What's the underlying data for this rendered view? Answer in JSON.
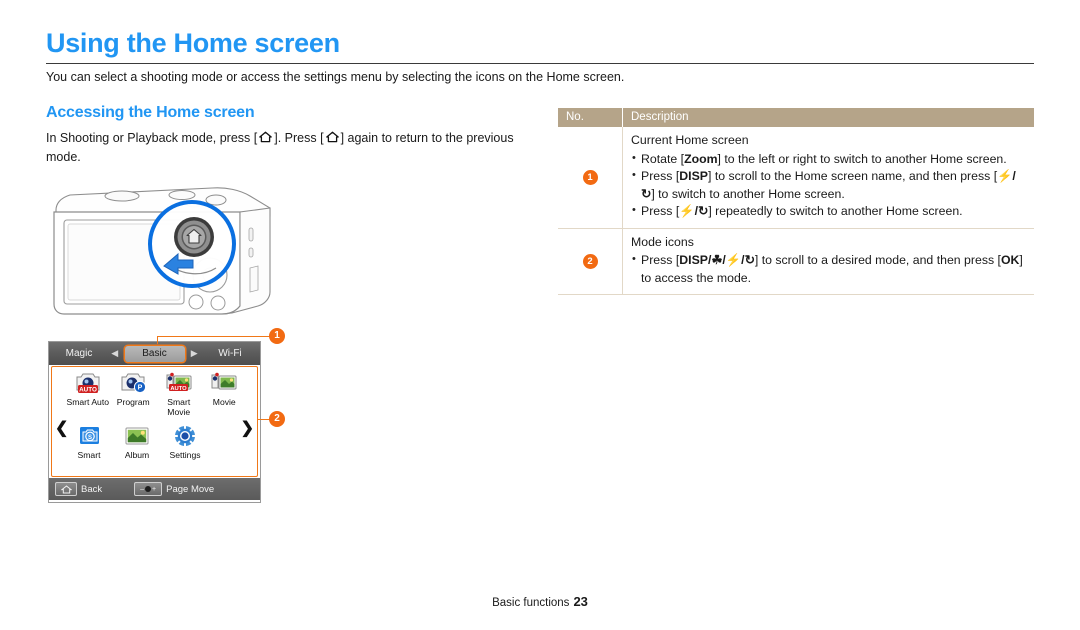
{
  "page": {
    "title": "Using the Home screen",
    "intro": "You can select a shooting mode or access the settings menu by selecting the icons on the Home screen.",
    "footer_label": "Basic functions",
    "footer_page": "23",
    "accent_blue": "#2196f3",
    "accent_orange": "#f26a12",
    "table_header_bg": "#b5a489"
  },
  "section": {
    "heading": "Accessing the Home screen",
    "body_part1": "In Shooting or Playback mode, press [",
    "body_part2": "]. Press [",
    "body_part3": "] again to return to the previous mode."
  },
  "camera_screen": {
    "tabs": {
      "left": "Magic",
      "center": "Basic",
      "right": "Wi-Fi",
      "arrow_left": "◀",
      "arrow_right": "▶"
    },
    "nav_left": "❮",
    "nav_right": "❯",
    "modes_row1": [
      {
        "label": "Smart Auto",
        "icon": "smart-auto-icon"
      },
      {
        "label": "Program",
        "icon": "program-icon"
      },
      {
        "label": "Smart Movie",
        "icon": "smart-movie-icon"
      },
      {
        "label": "Movie",
        "icon": "movie-icon"
      }
    ],
    "modes_row2": [
      {
        "label": "Smart",
        "icon": "smart-icon"
      },
      {
        "label": "Album",
        "icon": "album-icon"
      },
      {
        "label": "Settings",
        "icon": "settings-icon"
      }
    ],
    "bottom_bar": {
      "back_label": "Back",
      "page_move_label": "Page Move",
      "zoom_minus": "–",
      "zoom_plus": "+"
    }
  },
  "callouts": [
    {
      "number": "1"
    },
    {
      "number": "2"
    }
  ],
  "table": {
    "headers": {
      "no": "No.",
      "description": "Description"
    },
    "rows": [
      {
        "no": "1",
        "title": "Current Home screen",
        "bullets": [
          {
            "pre": "Rotate [",
            "key": "Zoom",
            "post": "] to the left or right to switch to another Home screen."
          },
          {
            "pre": "Press [",
            "key": "DISP",
            "mid": "] to scroll to the Home screen name, and then press [",
            "key2": "⚡/↻",
            "post": "] to switch to another Home screen."
          },
          {
            "pre": "Press [",
            "key": "⚡/↻",
            "post": "] repeatedly to switch to another Home screen."
          }
        ]
      },
      {
        "no": "2",
        "title": "Mode icons",
        "bullets": [
          {
            "pre": "Press [",
            "key": "DISP/☘/⚡/↻",
            "mid": "] to scroll to a desired mode, and then press [",
            "key2": "OK",
            "post": "] to access the mode."
          }
        ]
      }
    ]
  }
}
